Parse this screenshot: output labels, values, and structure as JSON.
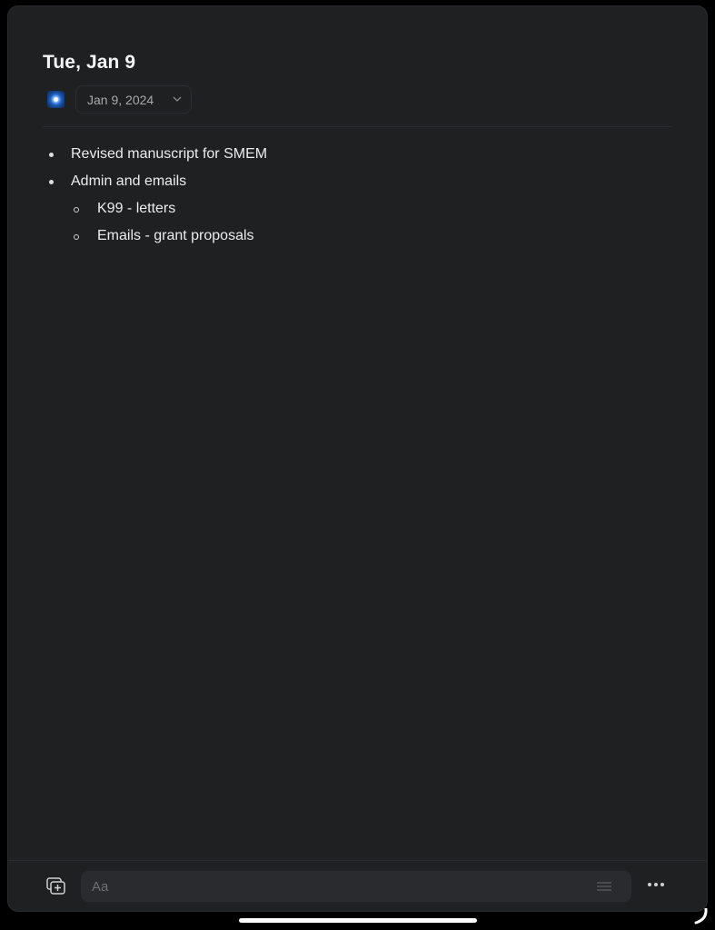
{
  "note": {
    "title": "Tue, Jan 9",
    "app_icon": "journal-app-icon",
    "date_selector": {
      "value": "Jan 9, 2024",
      "icon": "chevron-down-icon"
    },
    "items": [
      {
        "level": 1,
        "text": "Revised manuscript for SMEM"
      },
      {
        "level": 1,
        "text": "Admin and emails"
      },
      {
        "level": 2,
        "text": "K99 - letters"
      },
      {
        "level": 2,
        "text": "Emails - grant proposals"
      }
    ]
  },
  "bottom_bar": {
    "new_note_icon": "new-note-icon",
    "input": {
      "placeholder": "Aa",
      "value": ""
    },
    "format_icon": "text-format-icon",
    "more_icon": "more-icon"
  },
  "colors": {
    "background": "#1f2022",
    "text": "#ececec",
    "muted": "#a9a9ab",
    "input_bg": "#2a2b2e"
  }
}
